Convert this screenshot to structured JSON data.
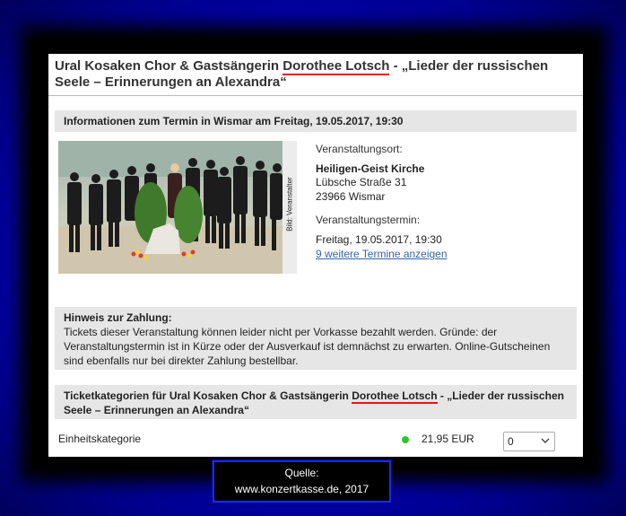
{
  "event": {
    "title_prefix": "Ural Kosaken Chor & Gastsängerin ",
    "title_name": "Dorothee Lotsch",
    "title_suffix": " - „Lieder der russischen Seele – Erinnerungen an Alexandra“",
    "info_header": "Informationen zum Termin in Wismar am Freitag, 19.05.2017, 19:30",
    "photo_credit": "Bild: Veranstalter",
    "venue_label": "Veranstaltungsort:",
    "venue_name": "Heiligen-Geist Kirche",
    "venue_street": "Lübsche Straße 31",
    "venue_city": "23966 Wismar",
    "date_label": "Veranstaltungstermin:",
    "date_value": "Freitag, 19.05.2017, 19:30",
    "more_dates_link": "9 weitere Termine anzeigen"
  },
  "payment_notice": {
    "title": "Hinweis zur Zahlung:",
    "body": "Tickets dieser Veranstaltung können leider nicht per Vorkasse bezahlt werden. Gründe: der Veranstaltungstermin ist in Kürze oder der Ausverkauf ist demnächst zu erwarten. Online-Gutscheinen sind ebenfalls nur bei direkter Zahlung bestellbar."
  },
  "tickets": {
    "header_prefix": "Ticketkategorien für Ural Kosaken Chor & Gastsängerin ",
    "header_name": "Dorothee Lotsch",
    "header_suffix": " - „Lieder der russischen Seele – Erinnerungen an Alexandra“",
    "category": "Einheitskategorie",
    "availability_color": "#2cc52c",
    "price": "21,95 EUR",
    "quantity": "0"
  },
  "source": {
    "line1": "Quelle:",
    "line2": "www.konzertkasse.de, 2017"
  },
  "colors": {
    "background": "#0000c8",
    "highlight_underline": "#ee1111",
    "link": "#3366aa"
  }
}
